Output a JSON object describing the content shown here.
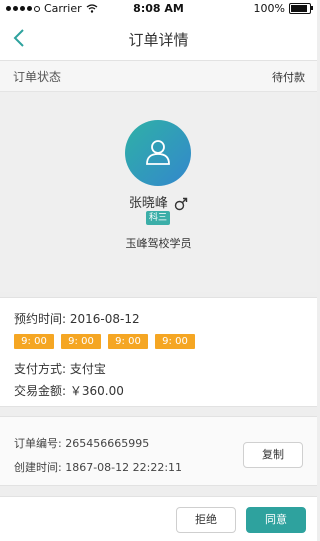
{
  "status_bar": {
    "carrier": "Carrier",
    "time": "8:08 AM",
    "battery": "100%",
    "battery_level": 1.0
  },
  "nav": {
    "title": "订单详情",
    "back_icon": "chevron-left-icon"
  },
  "order_status": {
    "label": "订单状态",
    "value": "待付款"
  },
  "student": {
    "name": "张晓峰",
    "gender_icon": "male-icon",
    "subject": "科三",
    "school": "玉峰驾校学员",
    "avatar_icon": "user-icon"
  },
  "booking": {
    "date_label": "预约时间:",
    "date": "2016-08-12",
    "time_slots": [
      "9: 00",
      "9: 00",
      "9: 00",
      "9: 00"
    ],
    "payment_label": "支付方式:",
    "payment": "支付宝",
    "amount_label": "交易金额:",
    "amount": "￥360.00"
  },
  "order_info": {
    "number_label": "订单编号:",
    "number": "265456665995",
    "created_label": "创建时间:",
    "created": "1867-08-12 22:22:11",
    "copy_label": "复制"
  },
  "actions": {
    "reject_label": "拒绝",
    "agree_label": "同意"
  },
  "colors": {
    "accent": "#2ea29e",
    "tag": "#f5a623",
    "badge": "#3baea8"
  }
}
